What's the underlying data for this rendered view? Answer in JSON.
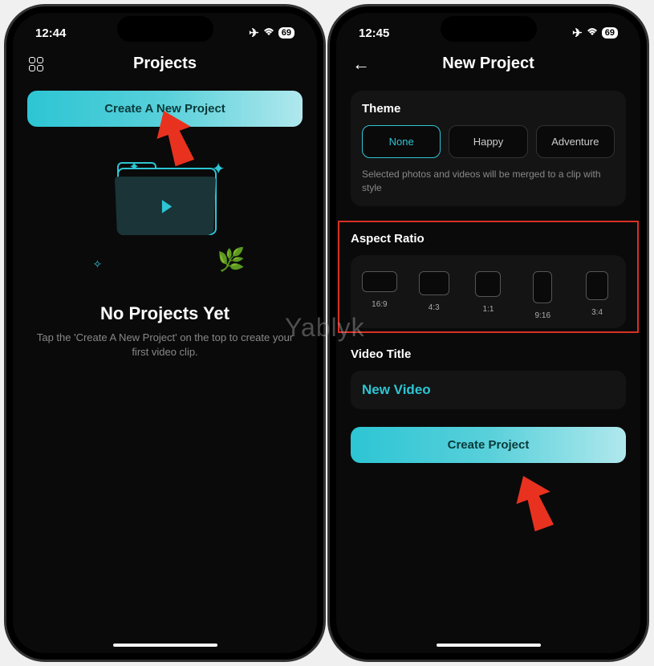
{
  "watermark": "Yablyk",
  "leftPhone": {
    "status": {
      "time": "12:44",
      "battery": "69"
    },
    "header": {
      "title": "Projects"
    },
    "createButton": "Create A New Project",
    "empty": {
      "title": "No Projects Yet",
      "subtitle": "Tap the 'Create A New Project' on the top to create your first video clip."
    }
  },
  "rightPhone": {
    "status": {
      "time": "12:45",
      "battery": "69"
    },
    "header": {
      "title": "New Project"
    },
    "theme": {
      "label": "Theme",
      "options": [
        "None",
        "Happy",
        "Adventure"
      ],
      "selected": "None",
      "hint": "Selected photos and videos will be merged to a clip with style"
    },
    "aspectRatio": {
      "label": "Aspect Ratio",
      "options": [
        "16:9",
        "4:3",
        "1:1",
        "9:16",
        "3:4"
      ]
    },
    "videoTitle": {
      "label": "Video Title",
      "value": "New Video"
    },
    "createButton": "Create Project"
  }
}
